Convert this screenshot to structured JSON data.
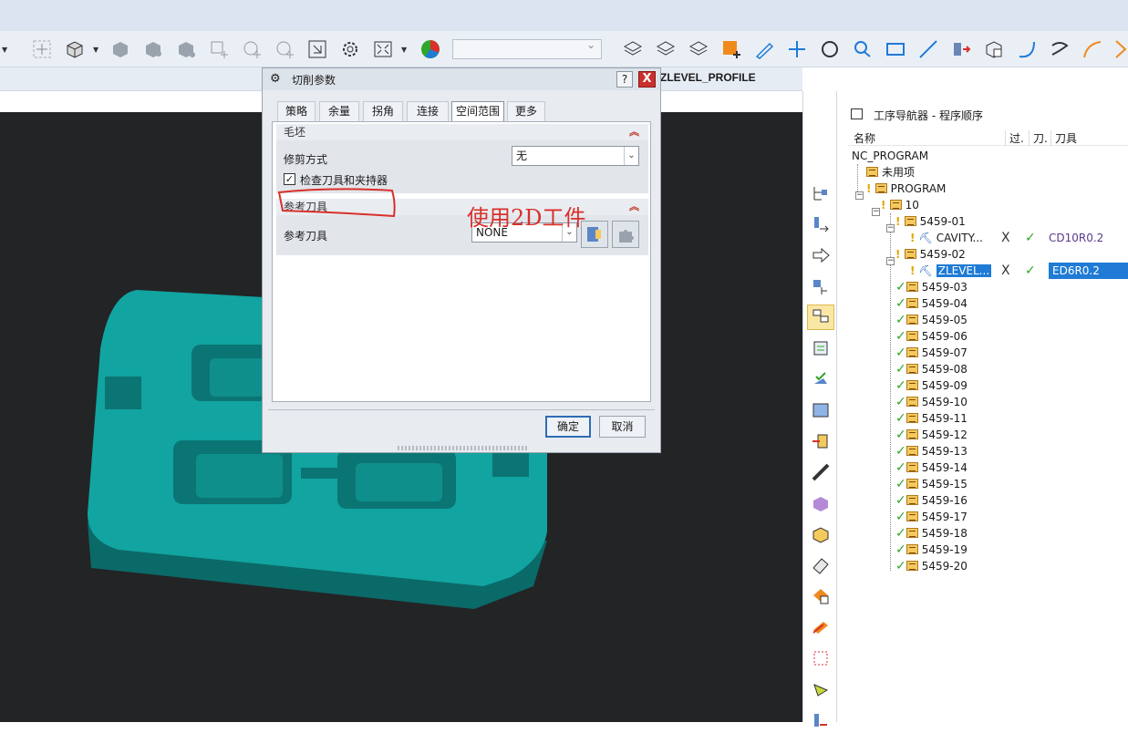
{
  "toolbar": {
    "combo_value": "",
    "icons": [
      "snap-icon",
      "solid-box-icon",
      "shaded-box-icon",
      "shaded-multi-icon",
      "shaded-group-icon",
      "sketch-point-icon",
      "rotate-point-icon",
      "search-point-icon",
      "fit-view-icon",
      "settings-icon",
      "zoom-fit-icon",
      "color-wheel-icon",
      "tool-layers-icon",
      "operation-layers-icon",
      "program-layers-icon",
      "orange-cube-icon",
      "pen-icon",
      "plus-icon",
      "circle-icon",
      "arc-icon",
      "rectangle-icon",
      "line-icon",
      "probe-icon",
      "cube-op-icon",
      "curve-icon",
      "curve-s-icon",
      "curve-arc-icon",
      "chevron-right-icon"
    ]
  },
  "operation_title": "ZLEVEL_PROFILE",
  "dialog": {
    "title": "切削参数",
    "help_label": "?",
    "close_label": "X",
    "tabs": [
      "策略",
      "余量",
      "拐角",
      "连接",
      "空间范围",
      "更多"
    ],
    "active_tab": "空间范围",
    "blank_group": {
      "header": "毛坯",
      "trim_label": "修剪方式",
      "trim_value": "无",
      "check_label": "检查刀具和夹持器",
      "check_mark": "✓"
    },
    "ref_group": {
      "header": "参考刀具",
      "ref_label": "参考刀具",
      "ref_value": "NONE"
    },
    "ok_label": "确定",
    "cancel_label": "取消",
    "annotation": "使用2D工件"
  },
  "navigator": {
    "title": "工序导航器 - 程序顺序",
    "columns": [
      "名称",
      "过.",
      "刀.",
      "刀具"
    ],
    "rows": [
      {
        "name": "NC_PROGRAM",
        "indent": 0,
        "kind": "root"
      },
      {
        "name": "未用项",
        "indent": 1,
        "kind": "folder"
      },
      {
        "name": "PROGRAM",
        "indent": 1,
        "kind": "folder-excl"
      },
      {
        "name": "10",
        "indent": 2,
        "kind": "folder-excl"
      },
      {
        "name": "5459-01",
        "indent": 3,
        "kind": "folder-excl"
      },
      {
        "name": "CAVITY...",
        "indent": 4,
        "kind": "op",
        "x": "X",
        "ok": "✓",
        "tool": "CD10R0.2"
      },
      {
        "name": "5459-02",
        "indent": 3,
        "kind": "folder-excl"
      },
      {
        "name": "ZLEVEL...",
        "indent": 4,
        "kind": "op",
        "x": "X",
        "ok": "✓",
        "tool": "ED6R0.2",
        "selected": true
      },
      {
        "name": "5459-03",
        "indent": 3,
        "kind": "folder-check"
      },
      {
        "name": "5459-04",
        "indent": 3,
        "kind": "folder-check"
      },
      {
        "name": "5459-05",
        "indent": 3,
        "kind": "folder-check"
      },
      {
        "name": "5459-06",
        "indent": 3,
        "kind": "folder-check"
      },
      {
        "name": "5459-07",
        "indent": 3,
        "kind": "folder-check"
      },
      {
        "name": "5459-08",
        "indent": 3,
        "kind": "folder-check"
      },
      {
        "name": "5459-09",
        "indent": 3,
        "kind": "folder-check"
      },
      {
        "name": "5459-10",
        "indent": 3,
        "kind": "folder-check"
      },
      {
        "name": "5459-11",
        "indent": 3,
        "kind": "folder-check"
      },
      {
        "name": "5459-12",
        "indent": 3,
        "kind": "folder-check"
      },
      {
        "name": "5459-13",
        "indent": 3,
        "kind": "folder-check"
      },
      {
        "name": "5459-14",
        "indent": 3,
        "kind": "folder-check"
      },
      {
        "name": "5459-15",
        "indent": 3,
        "kind": "folder-check"
      },
      {
        "name": "5459-16",
        "indent": 3,
        "kind": "folder-check"
      },
      {
        "name": "5459-17",
        "indent": 3,
        "kind": "folder-check"
      },
      {
        "name": "5459-18",
        "indent": 3,
        "kind": "folder-check"
      },
      {
        "name": "5459-19",
        "indent": 3,
        "kind": "folder-check"
      },
      {
        "name": "5459-20",
        "indent": 3,
        "kind": "folder-check"
      }
    ]
  },
  "vertical_toolbar": [
    "machine-tree-icon",
    "drill-arrow-icon",
    "move-right-icon",
    "tool-view-icon",
    "program-order-icon",
    "operation-list-icon",
    "mill-check-icon",
    "calendar-icon",
    "import-icon",
    "ruler-icon",
    "workpiece-icon",
    "stock-icon",
    "geometry-icon",
    "orange-transform-icon",
    "layer-stack-icon",
    "wire-cube-icon",
    "cone-icon",
    "bottom-tool-icon"
  ],
  "colors": {
    "part": "#0e8c8a",
    "viewport_bg": "#232426",
    "selection": "#1f7bd6",
    "annotation": "#d9302a"
  }
}
